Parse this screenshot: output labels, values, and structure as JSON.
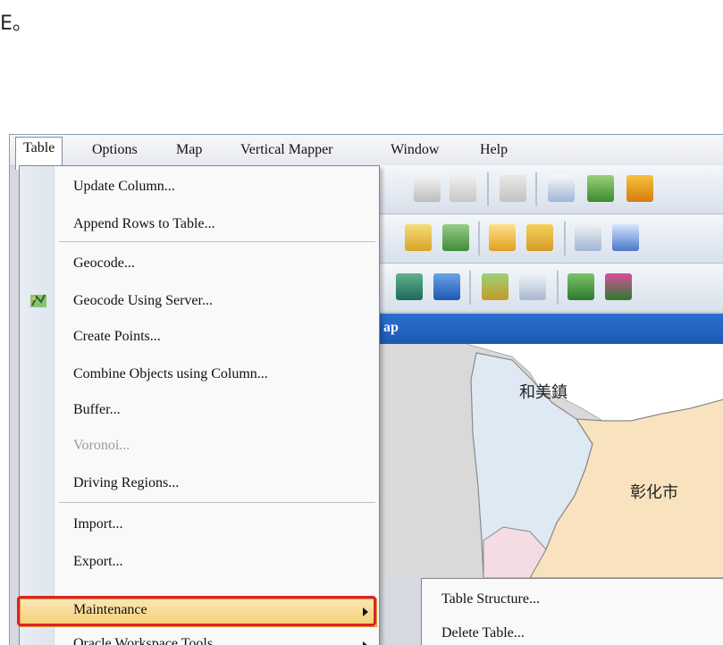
{
  "top_text": "E。",
  "menubar": {
    "items": [
      "Table",
      "Options",
      "Map",
      "Vertical Mapper",
      "Window",
      "Help"
    ]
  },
  "dropdown": {
    "items": [
      {
        "label": "Update Column...",
        "disabled": false
      },
      {
        "label": "Append Rows to Table...",
        "disabled": false
      },
      {
        "label": "Geocode...",
        "disabled": false
      },
      {
        "label": "Geocode Using Server...",
        "disabled": false
      },
      {
        "label": "Create Points...",
        "disabled": false
      },
      {
        "label": "Combine Objects using Column...",
        "disabled": false
      },
      {
        "label": "Buffer...",
        "disabled": false
      },
      {
        "label": "Voronoi...",
        "disabled": true
      },
      {
        "label": "Driving Regions...",
        "disabled": false
      },
      {
        "label": "Import...",
        "disabled": false
      },
      {
        "label": "Export...",
        "disabled": false
      },
      {
        "label": "Maintenance",
        "disabled": false,
        "submenu": true
      },
      {
        "label": "Oracle Workspace Tools",
        "disabled": false,
        "submenu": true
      }
    ]
  },
  "submenu": {
    "items": [
      "Table Structure...",
      "Delete Table..."
    ]
  },
  "map_window": {
    "title_fragment": "ap",
    "labels": [
      "和美鎮",
      "彰化市"
    ]
  },
  "colors": {
    "highlight": "#f5cf74",
    "red_outline": "#e0202a",
    "titlebar": "#1e58b4"
  }
}
